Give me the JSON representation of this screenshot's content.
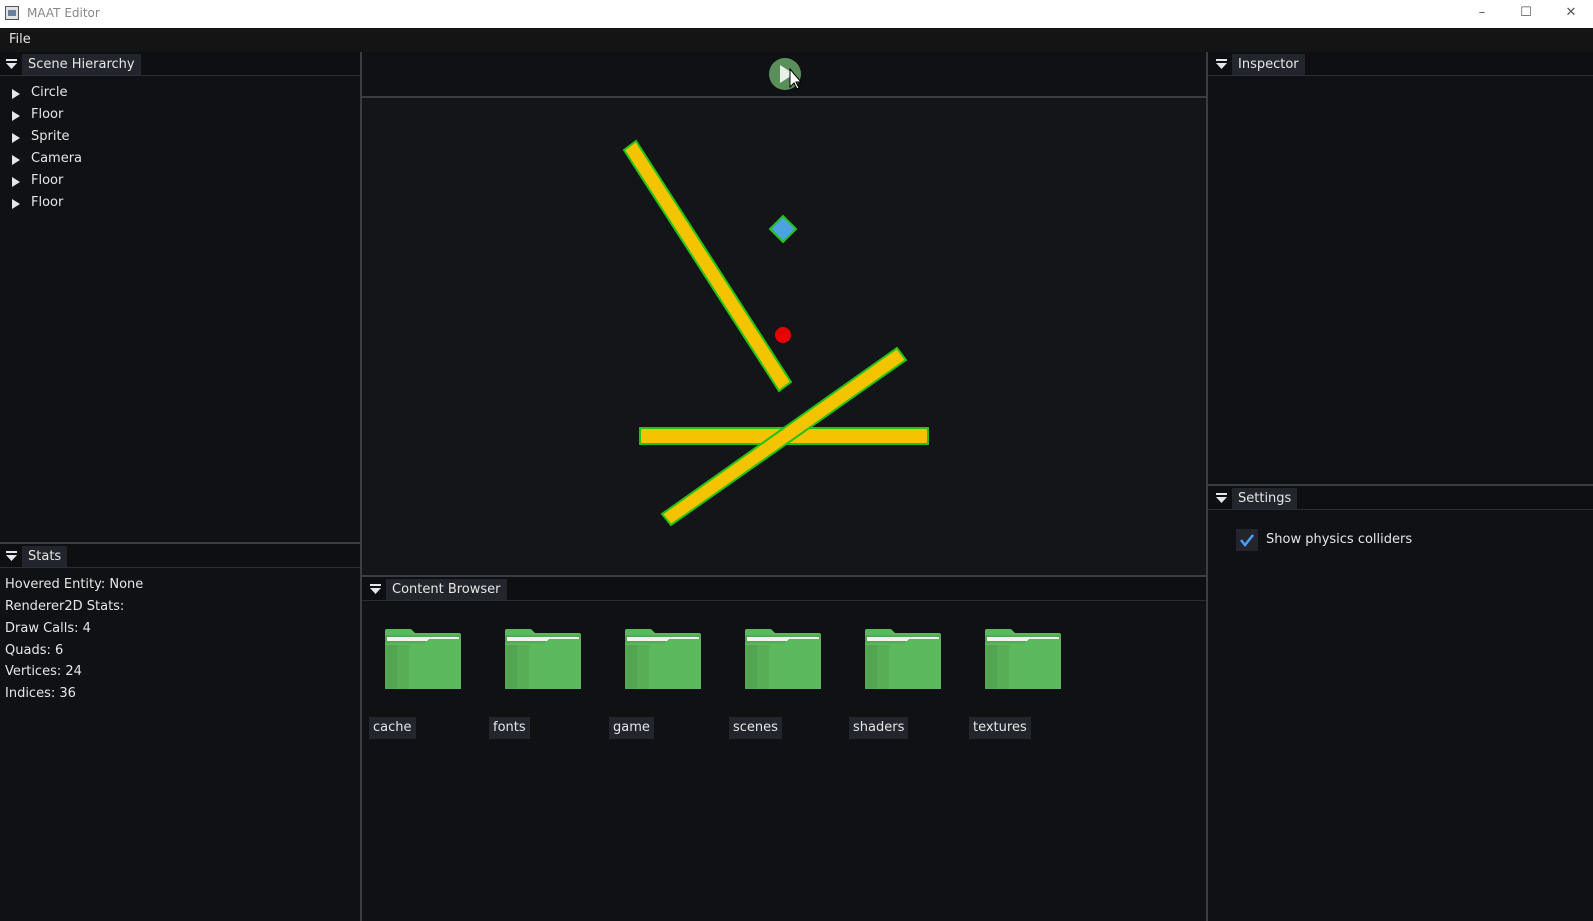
{
  "window": {
    "title": "MAAT Editor",
    "controls": [
      "minimize",
      "maximize",
      "close"
    ]
  },
  "menu": {
    "items": [
      "File"
    ]
  },
  "scene_hierarchy": {
    "title": "Scene Hierarchy",
    "items": [
      "Circle",
      "Floor",
      "Sprite",
      "Camera",
      "Floor",
      "Floor"
    ]
  },
  "stats": {
    "title": "Stats",
    "lines": [
      "Hovered Entity: None",
      "Renderer2D Stats:",
      "Draw Calls: 4",
      "Quads: 6",
      "Vertices: 24",
      "Indices: 36"
    ]
  },
  "toolbar": {
    "play_icon": "play-icon"
  },
  "viewport": {
    "colors": {
      "floor_fill": "#f5c400",
      "collider_outline": "#22c21a",
      "circle": "#e80000",
      "sprite": "#4da3e0"
    }
  },
  "content_browser": {
    "title": "Content Browser",
    "folders": [
      "cache",
      "fonts",
      "game",
      "scenes",
      "shaders",
      "textures"
    ]
  },
  "inspector": {
    "title": "Inspector"
  },
  "settings": {
    "title": "Settings",
    "show_physics_colliders": {
      "label": "Show physics colliders",
      "checked": true
    }
  },
  "colors": {
    "accent": "#4a9eff",
    "folder": "#5cb85c",
    "panel_bg": "#0f1115",
    "tab_bg": "#22252b"
  }
}
